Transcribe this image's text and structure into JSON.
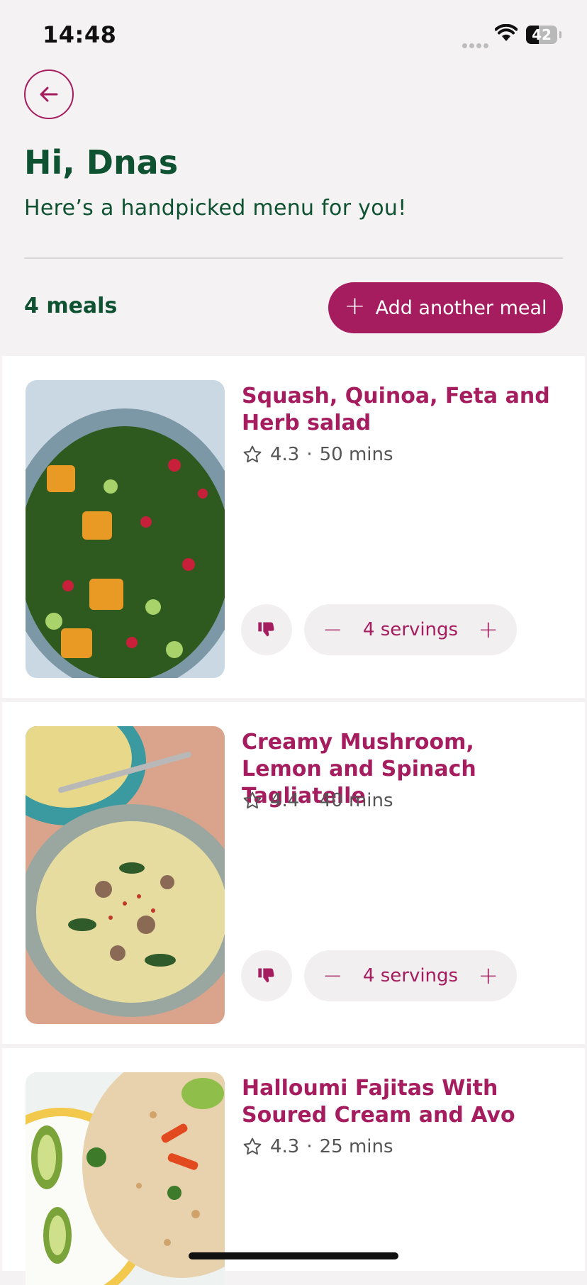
{
  "status_bar": {
    "time": "14:48",
    "battery": "42",
    "battery_level": 0.42
  },
  "header": {
    "greeting": "Hi, Dnas",
    "subtitle": "Here’s a handpicked menu for you!"
  },
  "toolbar": {
    "meal_count": "4 meals",
    "add_meal_label": "Add another meal"
  },
  "recipes": [
    {
      "title": "Squash, Quinoa, Feta and Herb salad",
      "rating": "4.3",
      "duration": "50 mins",
      "servings": "4 servings"
    },
    {
      "title": "Creamy Mushroom, Lemon and Spinach Tagliatelle",
      "rating": "4.4",
      "duration": "40 mins",
      "servings": "4 servings"
    },
    {
      "title": "Halloumi Fajitas With Soured Cream and Avo",
      "rating": "4.3",
      "duration": "25 mins"
    }
  ],
  "meta_separator": "·",
  "stepper": {
    "minus": "−",
    "plus": "+"
  },
  "colors": {
    "accent": "#a61d5f",
    "heading": "#0e5232",
    "background": "#f4f2f3"
  },
  "icons": [
    "back-arrow-icon",
    "star-icon",
    "thumbs-down-icon",
    "plus-icon",
    "minus-icon",
    "wifi-icon"
  ]
}
